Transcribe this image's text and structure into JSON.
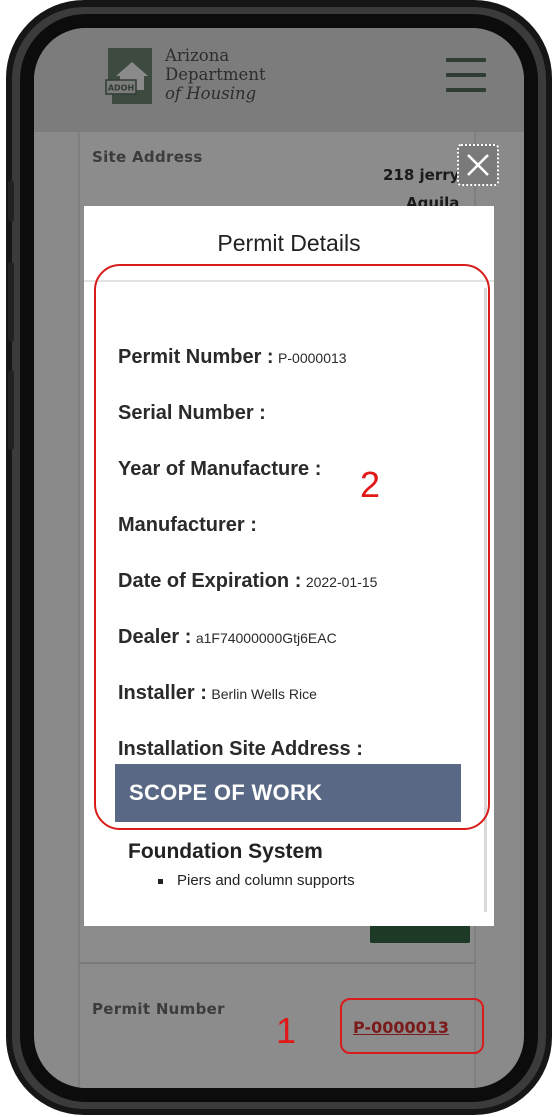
{
  "header": {
    "logo_badge": "ADOH",
    "logo_line1": "Arizona",
    "logo_line2": "Department",
    "logo_line3": "of Housing"
  },
  "background": {
    "site_address_label": "Site Address",
    "site_address_value": "218 jerry",
    "site_address_value2": "Aguila",
    "permit_number_label": "Permit Number",
    "permit_number_link": "P-0000013"
  },
  "modal": {
    "title": "Permit Details",
    "fields": [
      {
        "label": "Permit Number :",
        "value": "P-0000013"
      },
      {
        "label": "Serial Number :",
        "value": ""
      },
      {
        "label": "Year of Manufacture :",
        "value": ""
      },
      {
        "label": "Manufacturer :",
        "value": ""
      },
      {
        "label": "Date of Expiration :",
        "value": "2022-01-15"
      },
      {
        "label": "Dealer :",
        "value": "a1F74000000Gtj6EAC"
      },
      {
        "label": "Installer :",
        "value": "Berlin Wells Rice"
      },
      {
        "label": "Installation Site Address :",
        "value": ""
      }
    ],
    "scope_heading": "SCOPE OF WORK",
    "foundation_heading": "Foundation System",
    "foundation_items": [
      "Piers and column supports"
    ]
  },
  "annotations": {
    "marker_1": "1",
    "marker_2": "2"
  },
  "colors": {
    "annotation_red": "#d81c1c",
    "scope_bar": "#596985",
    "logo_green": "#2f3d32"
  }
}
